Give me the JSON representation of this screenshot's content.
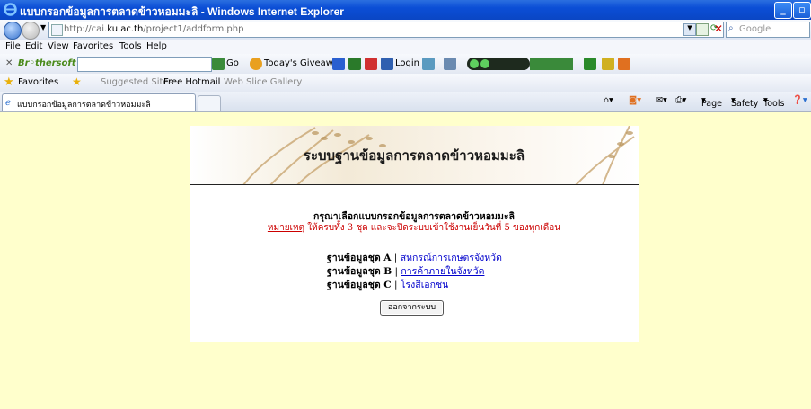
{
  "window": {
    "title": "แบบกรอกข้อมูลการตลาดข้าวหอมมะลิ - Windows Internet Explorer"
  },
  "address": {
    "url_prefix": "http://cai.",
    "url_domain": "ku.ac.th",
    "url_path": "/project1/addform.php",
    "search_placeholder": "Google"
  },
  "menu": {
    "file": "File",
    "edit": "Edit",
    "view": "View",
    "favorites": "Favorites",
    "tools": "Tools",
    "help": "Help"
  },
  "toolbar": {
    "brothersoft": "Br◦thersoft",
    "go": "Go",
    "giveaway": "Today's Giveaway",
    "login": "Login"
  },
  "favbar": {
    "favorites": "Favorites",
    "suggested": "Suggested Sites",
    "hotmail": "Free Hotmail",
    "webslice": "Web Slice Gallery"
  },
  "tab": {
    "label": "แบบกรอกข้อมูลการตลาดข้าวหอมมะลิ"
  },
  "cmdbar": {
    "page": "Page",
    "safety": "Safety",
    "tools": "Tools"
  },
  "page": {
    "title": "ระบบฐานข้อมูลการตลาดข้าวหอมมะลิ",
    "instruction": "กรุณาเลือกแบบกรอกข้อมูลการตลาดข้าวหอมมะลิ",
    "note_link": "หมายเหตุ",
    "note_text": " ให้ครบทั้ง 3 ชุด และจะปิดระบบเข้าใช้งานเย็นวันที่ 5 ของทุกเดือน",
    "rows": [
      {
        "label": "ฐานข้อมูลชุด A",
        "sep": " | ",
        "link": "สหกรณ์การเกษตรจังหวัด"
      },
      {
        "label": "ฐานข้อมูลชุด B",
        "sep": " | ",
        "link": "การค้าภายในจังหวัด"
      },
      {
        "label": "ฐานข้อมูลชุด C",
        "sep": " | ",
        "link": "โรงสีเอกชน"
      }
    ],
    "logout": "ออกจากระบบ"
  },
  "colors": {
    "page_bg": "#ffffcc",
    "note_red": "#cc0000",
    "link_blue": "#0000cc"
  }
}
